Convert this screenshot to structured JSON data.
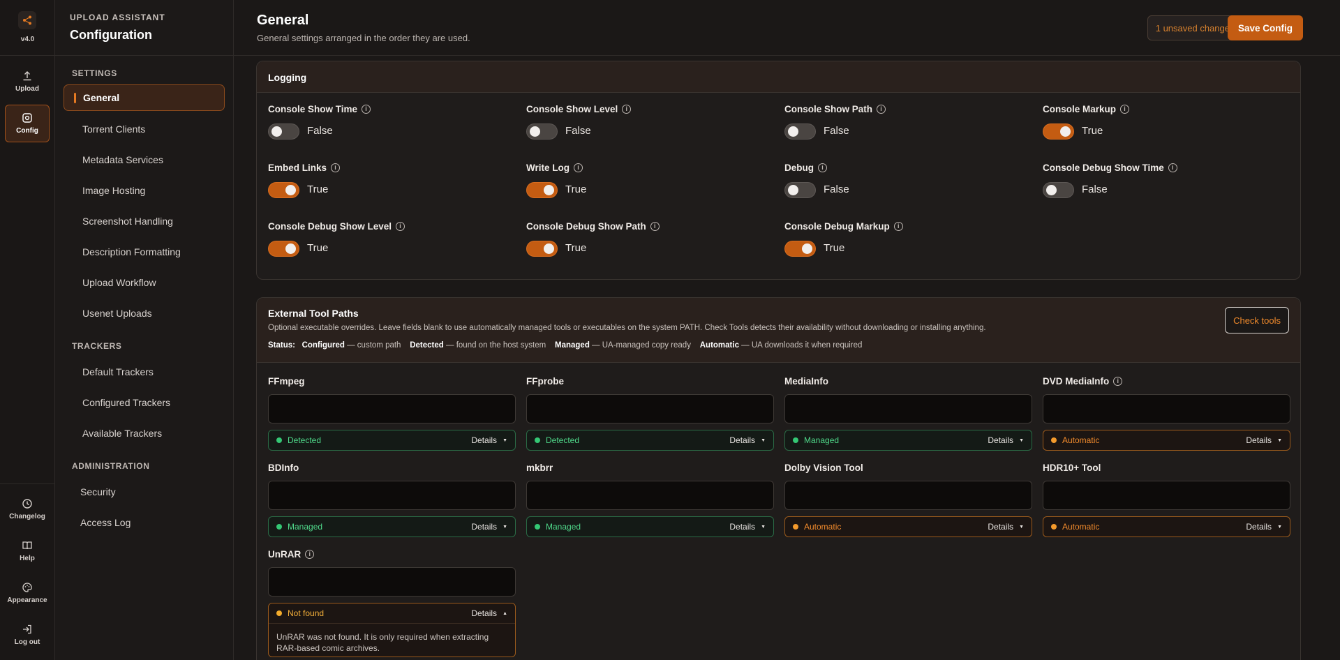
{
  "rail": {
    "version": "v4.0",
    "upload": "Upload",
    "config": "Config",
    "changelog": "Changelog",
    "help": "Help",
    "appearance": "Appearance",
    "logout": "Log out"
  },
  "nav": {
    "eyebrow": "UPLOAD ASSISTANT",
    "title": "Configuration",
    "settings_heading": "SETTINGS",
    "settings": [
      "General",
      "Torrent Clients",
      "Metadata Services",
      "Image Hosting",
      "Screenshot Handling",
      "Description Formatting",
      "Upload Workflow",
      "Usenet Uploads"
    ],
    "trackers_heading": "TRACKERS",
    "trackers": [
      "Default Trackers",
      "Configured Trackers",
      "Available Trackers"
    ],
    "admin_heading": "ADMINISTRATION",
    "admin": [
      "Security",
      "Access Log"
    ]
  },
  "header": {
    "title": "General",
    "subtitle": "General settings arranged in the order they are used.",
    "unsaved": "1 unsaved change",
    "save": "Save Config"
  },
  "logging": {
    "title": "Logging",
    "fields": [
      {
        "label": "Console Show Time",
        "value": false,
        "text": "False"
      },
      {
        "label": "Console Show Level",
        "value": false,
        "text": "False"
      },
      {
        "label": "Console Show Path",
        "value": false,
        "text": "False"
      },
      {
        "label": "Console Markup",
        "value": true,
        "text": "True"
      },
      {
        "label": "Embed Links",
        "value": true,
        "text": "True"
      },
      {
        "label": "Write Log",
        "value": true,
        "text": "True"
      },
      {
        "label": "Debug",
        "value": false,
        "text": "False"
      },
      {
        "label": "Console Debug Show Time",
        "value": false,
        "text": "False"
      },
      {
        "label": "Console Debug Show Level",
        "value": true,
        "text": "True"
      },
      {
        "label": "Console Debug Show Path",
        "value": true,
        "text": "True"
      },
      {
        "label": "Console Debug Markup",
        "value": true,
        "text": "True"
      }
    ]
  },
  "tools": {
    "title": "External Tool Paths",
    "description": "Optional executable overrides. Leave fields blank to use automatically managed tools or executables on the system PATH. Check Tools detects their availability without downloading or installing anything.",
    "check_button": "Check tools",
    "legend": {
      "status": "Status:",
      "configured": "Configured",
      "configured_desc": "— custom path",
      "detected": "Detected",
      "detected_desc": "— found on the host system",
      "managed": "Managed",
      "managed_desc": "— UA-managed copy ready",
      "automatic": "Automatic",
      "automatic_desc": "— UA downloads it when required"
    },
    "details_label": "Details",
    "items": [
      {
        "label": "FFmpeg",
        "status": "Detected"
      },
      {
        "label": "FFprobe",
        "status": "Detected"
      },
      {
        "label": "MediaInfo",
        "status": "Managed"
      },
      {
        "label": "DVD MediaInfo",
        "status": "Automatic"
      },
      {
        "label": "BDInfo",
        "status": "Managed"
      },
      {
        "label": "mkbrr",
        "status": "Managed"
      },
      {
        "label": "Dolby Vision Tool",
        "status": "Automatic"
      },
      {
        "label": "HDR10+ Tool",
        "status": "Automatic"
      },
      {
        "label": "UnRAR",
        "status": "Not found",
        "message": "UnRAR was not found. It is only required when extracting RAR-based comic archives."
      }
    ]
  }
}
